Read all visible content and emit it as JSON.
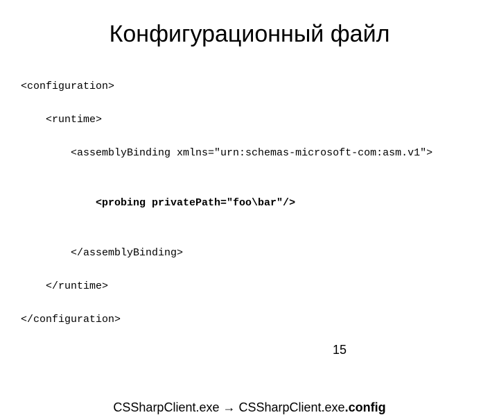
{
  "title": "Конфигурационный файл",
  "code": {
    "line1": "<configuration>",
    "line2": "    <runtime>",
    "line3": "        <assemblyBinding xmlns=\"urn:schemas-microsoft-com:asm.v1\">",
    "line4": "",
    "line5": "            <probing privatePath=\"foo\\bar\"/>",
    "line6": "",
    "line7": "        </assemblyBinding>",
    "line8": "    </runtime>",
    "line9": "</configuration>"
  },
  "caption_pre": "CSSharpClient.exe  →  CSSharpClient.exe",
  "caption_bold": ".config",
  "page_number": "15"
}
